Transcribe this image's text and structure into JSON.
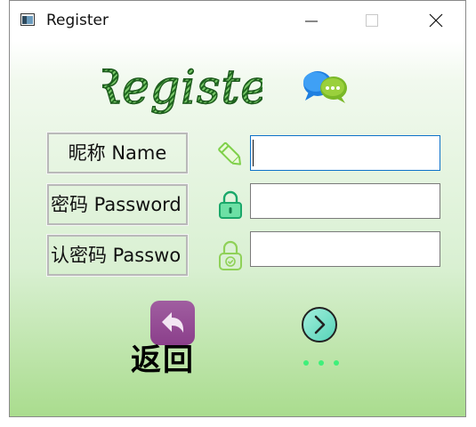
{
  "window": {
    "title": "Register"
  },
  "banner": {
    "text": "Registe"
  },
  "form": {
    "nickname_label": "昵称 Name",
    "password_label": "密码 Password",
    "confirm_label": "认密码 Passwo",
    "nickname_value": "",
    "password_value": "",
    "confirm_value": ""
  },
  "actions": {
    "back_label": "返回"
  },
  "icons": {
    "app": "window-icon",
    "banner": "chat-bubbles-icon",
    "nickname": "pencil-icon",
    "password": "lock-icon",
    "confirm": "lock-check-icon",
    "back": "reply-arrow-icon",
    "next": "chevron-right-circle-icon",
    "loading": "dots-icon"
  },
  "colors": {
    "focus_border": "#0d72c9",
    "back_button": "#9a509a",
    "next_button": "#7ee0c8",
    "dots": "#3ef07a"
  }
}
